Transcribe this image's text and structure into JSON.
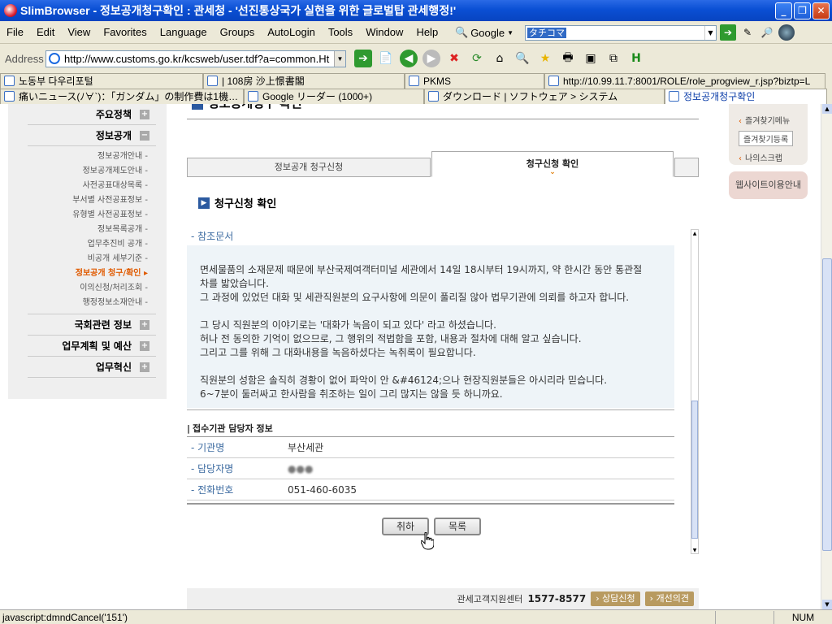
{
  "window": {
    "title": "SlimBrowser - 정보공개청구확인 : 관세청 - '선진통상국가 실현을 위한 글로벌탑 관세행정!'"
  },
  "menu": [
    "File",
    "Edit",
    "View",
    "Favorites",
    "Language",
    "Groups",
    "AutoLogin",
    "Tools",
    "Window",
    "Help"
  ],
  "search": {
    "engine": "Google",
    "value": "タチコマ"
  },
  "address": {
    "label": "Address",
    "url": "http://www.customs.go.kr/kcsweb/user.tdf?a=common.Ht"
  },
  "tabs_row1": [
    "노동부 다우리포털",
    "| 108房 沙上憬書閣",
    "PKMS",
    "http://10.99.11.7:8001/ROLE/role_progview_r.jsp?biztp=L"
  ],
  "tabs_row2": [
    "痛いニュース(ﾉ∀`)：「ガンダム」の制作費は1機…",
    "Google リーダー (1000+)",
    "ダウンロード | ソフトウェア > システム",
    "정보공개청구확인"
  ],
  "sidebar": {
    "sections": [
      "주요정책",
      "정보공개",
      "국회관련 정보",
      "업무계획 및 예산",
      "업무혁신"
    ],
    "items": [
      "정보공개안내 -",
      "정보공개제도안내 -",
      "사전공표대상목록 -",
      "부서별 사전공표정보 -",
      "유형별 사전공표정보 -",
      "정보목록공개 -",
      "업무추진비 공개 -",
      "비공개 세부기준 -",
      "정보공개 청구/확인 ▸",
      "이의신청/처리조회 -",
      "행정정보소재안내 -"
    ]
  },
  "main": {
    "page_title_cut": "정보공개청구 확인",
    "tab_left": "정보공개 청구신청",
    "tab_active": "청구신청 확인",
    "section_title": "청구신청 확인",
    "ref_label": "- 참조문서",
    "ref_lines": [
      "면세물품의 소재문제 때문에 부산국제여객터미널 세관에서 14일 18시부터 19시까지, 약 한시간 동안 통관절",
      "차를 밟았습니다.",
      "그 과정에 있었던 대화 및 세관직원분의 요구사항에 의문이 풀리질 않아 법무기관에 의뢰를 하고자 합니다.",
      "",
      "그 당시 직원분의 이야기로는 '대화가 녹음이 되고 있다' 라고 하셨습니다.",
      "허나 전 동의한 기억이 없으므로, 그 행위의 적법함을 포함, 내용과 절차에 대해 알고 싶습니다.",
      "그리고 그를 위해 그 대화내용을 녹음하셨다는 녹취록이 필요합니다.",
      "",
      "직원분의 성함은 솔직히 경황이 없어 파악이 안 &#46124;으나 현장직원분들은 아시리라 믿습니다.",
      "6~7분이 둘러싸고 한사람을 취조하는 일이 그리 많지는 않을 듯 하니까요."
    ],
    "receiver_title": "접수기관 담당자 정보",
    "info": [
      {
        "key": "- 기관명",
        "value": "부산세관"
      },
      {
        "key": "- 담당자명",
        "value": "●●●"
      },
      {
        "key": "- 전화번호",
        "value": "051-460-6035"
      }
    ],
    "buttons": {
      "cancel": "취하",
      "list": "목록"
    }
  },
  "footer": {
    "center": "관세고객지원센터",
    "phone": "1577-8577",
    "consult": "상담신청",
    "improve": "개선의견"
  },
  "right": {
    "fav_menu": "즐겨찾기메뉴",
    "fav_add": "즐겨찾기등록",
    "my_scrap": "나의스크랩",
    "site_guide": "웹사이트이용안내"
  },
  "status": {
    "message": "javascript:dmndCancel('151')",
    "num": "NUM"
  }
}
